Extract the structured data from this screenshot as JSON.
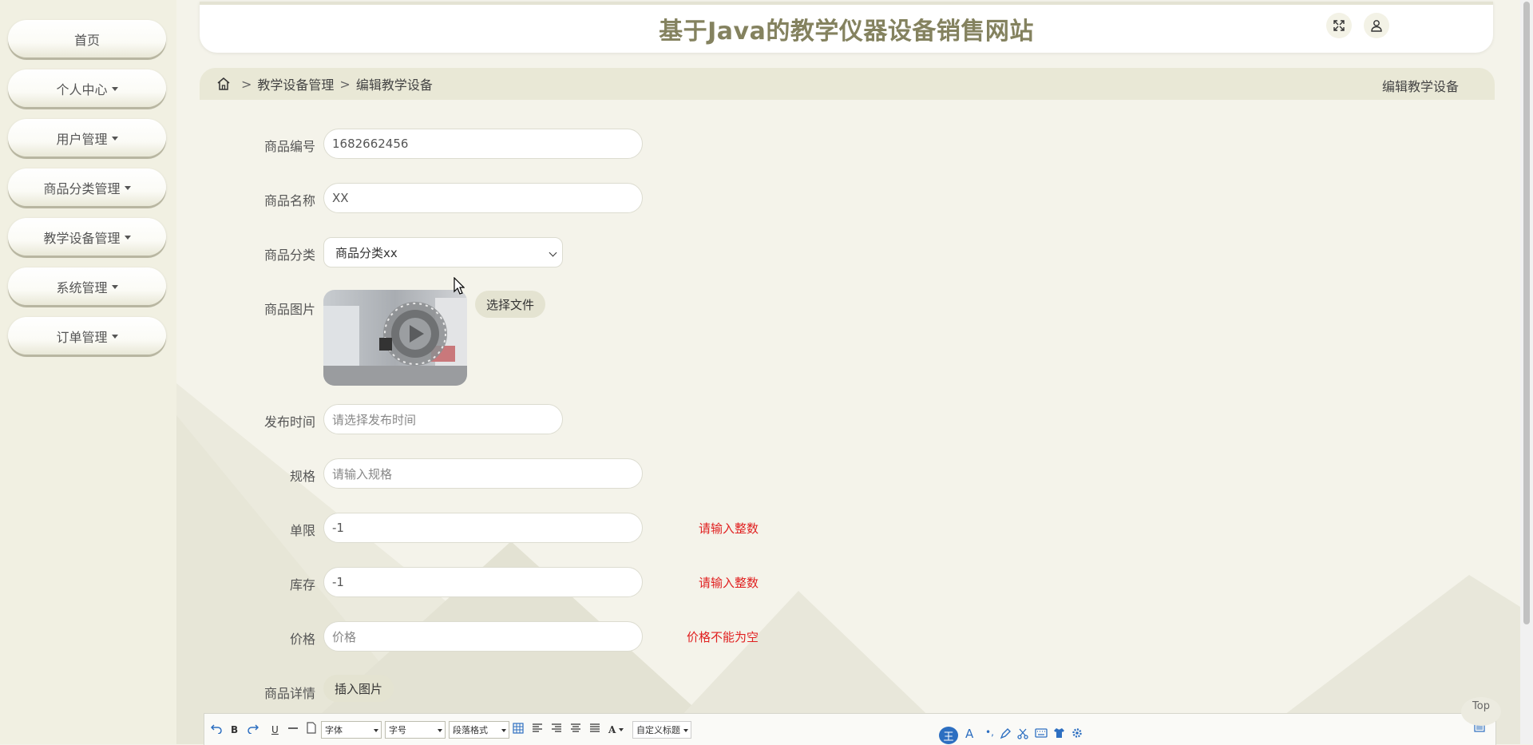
{
  "site": {
    "title": "基于Java的教学仪器设备销售网站"
  },
  "sidebar": {
    "items": [
      {
        "label": "首页",
        "dropdown": false
      },
      {
        "label": "个人中心",
        "dropdown": true
      },
      {
        "label": "用户管理",
        "dropdown": true
      },
      {
        "label": "商品分类管理",
        "dropdown": true
      },
      {
        "label": "教学设备管理",
        "dropdown": true
      },
      {
        "label": "系统管理",
        "dropdown": true
      },
      {
        "label": "订单管理",
        "dropdown": true
      }
    ]
  },
  "header": {
    "fullscreen_icon": "expand-icon",
    "user_icon": "user-icon"
  },
  "breadcrumb": {
    "sep": ">",
    "items": [
      "教学设备管理",
      "编辑教学设备"
    ],
    "right_title": "编辑教学设备"
  },
  "form": {
    "code": {
      "label": "商品编号",
      "value": "1682662456"
    },
    "name": {
      "label": "商品名称",
      "value": "XX"
    },
    "category": {
      "label": "商品分类",
      "value": "商品分类xx"
    },
    "image": {
      "label": "商品图片",
      "choose_label": "选择文件",
      "delete_icon": "trash-icon"
    },
    "publish_time": {
      "label": "发布时间",
      "placeholder": "请选择发布时间"
    },
    "spec": {
      "label": "规格",
      "placeholder": "请输入规格"
    },
    "limit": {
      "label": "单限",
      "value": "-1",
      "error": "请输入整数"
    },
    "stock": {
      "label": "库存",
      "value": "-1",
      "error": "请输入整数"
    },
    "price": {
      "label": "价格",
      "placeholder": "价格",
      "error": "价格不能为空"
    },
    "detail": {
      "label": "商品详情",
      "insert_label": "插入图片"
    }
  },
  "editor": {
    "font_select": "字体",
    "size_select": "字号",
    "para_select": "段落格式",
    "custom_select": "自定义标题",
    "bold": "B",
    "underline": "U",
    "fontcolor": "A"
  },
  "top_button": {
    "label": "Top"
  },
  "colors": {
    "accent": "#84825f",
    "error": "#e02020",
    "bar": "#e9e8d6"
  }
}
